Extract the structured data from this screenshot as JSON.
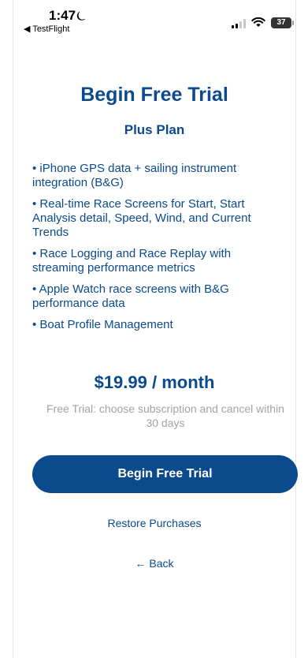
{
  "status_bar": {
    "time": "1:47",
    "moon_glyph": "⏾",
    "back_app": "◀ TestFlight",
    "battery": "37",
    "icons": [
      "moon-icon",
      "signal-icon",
      "wifi-icon",
      "battery-icon"
    ]
  },
  "page": {
    "title": "Begin Free Trial",
    "plan": "Plus Plan",
    "features": [
      "• iPhone GPS data + sailing instrument integration (B&G)",
      "• Real-time Race Screens for Start, Start Analysis detail, Speed, Wind, and Current Trends",
      "• Race Logging and Race Replay with streaming performance metrics",
      "• Apple Watch race screens with B&G performance data",
      "• Boat Profile Management"
    ],
    "price": "$19.99 / month",
    "trial_note": "Free Trial: choose subscription and cancel within 30 days",
    "cta_label": "Begin Free Trial",
    "restore_label": "Restore Purchases",
    "back_label": "← Back"
  },
  "colors": {
    "accent": "#0b4a8d",
    "muted": "#a3a3a3"
  }
}
